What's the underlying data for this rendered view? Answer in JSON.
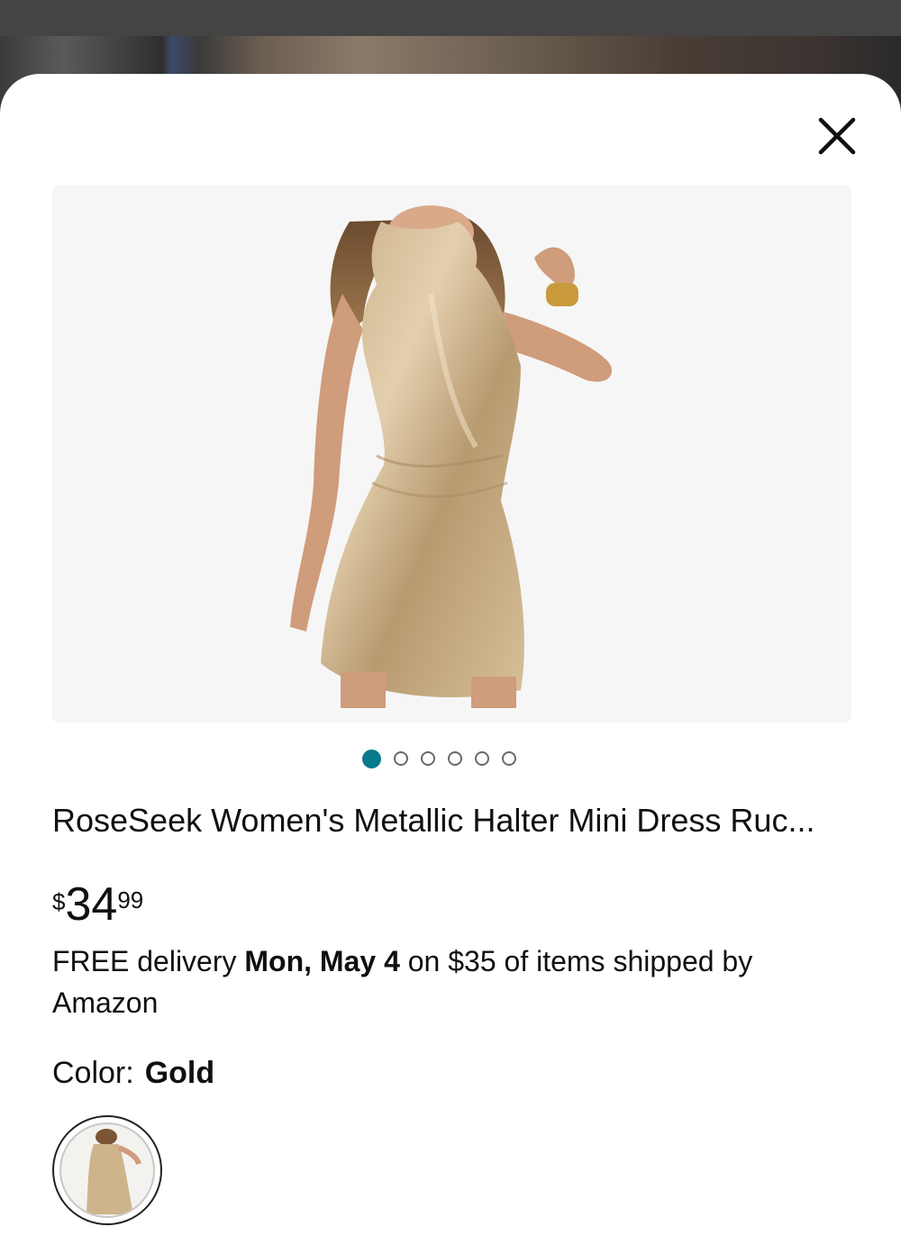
{
  "product": {
    "title": "RoseSeek Women's Metallic Halter Mini Dress Ruc...",
    "price": {
      "symbol": "$",
      "whole": "34",
      "fraction": "99"
    },
    "delivery": {
      "prefix": "FREE delivery ",
      "date": "Mon, May 4",
      "suffix": " on $35 of items shipped by Amazon"
    },
    "color": {
      "label": "Color:",
      "value": "Gold"
    }
  },
  "gallery": {
    "image_count": 6,
    "active_index": 0,
    "image_subject": "gold-metallic-halter-dress-photo"
  },
  "icons": {
    "close": "close-icon"
  },
  "colors": {
    "accent_dot": "#087a8c",
    "sheet": "#ffffff",
    "text": "#0f1111"
  }
}
